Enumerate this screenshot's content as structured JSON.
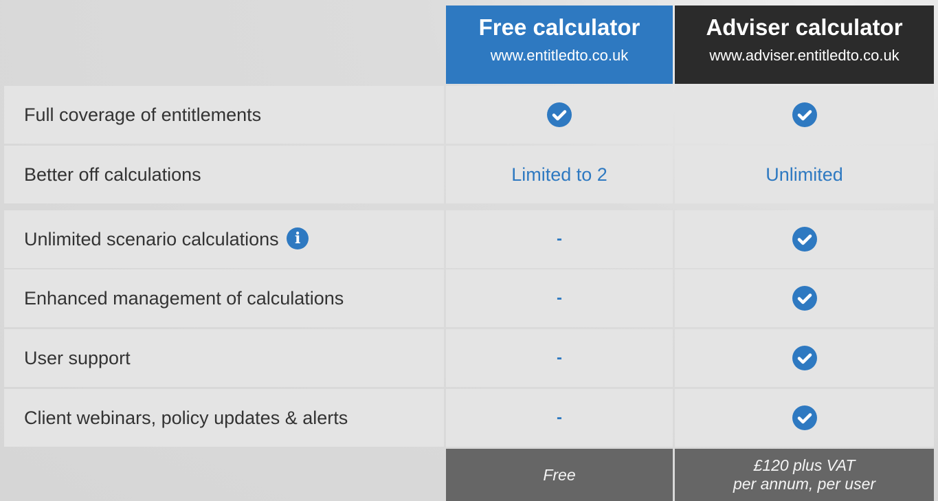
{
  "columns": {
    "free": {
      "title": "Free calculator",
      "url": "www.entitledto.co.uk"
    },
    "adviser": {
      "title": "Adviser calculator",
      "url": "www.adviser.entitledto.co.uk"
    }
  },
  "rows": [
    {
      "label": "Full coverage of entitlements",
      "free": "check-icon",
      "adviser": "check-icon"
    },
    {
      "label": "Better off calculations",
      "free": "Limited to 2",
      "adviser": "Unlimited"
    },
    {
      "label": "Unlimited scenario calculations",
      "info_icon": "info-icon",
      "free": "-",
      "adviser": "check-icon"
    },
    {
      "label": "Enhanced management of calculations",
      "free": "-",
      "adviser": "check-icon"
    },
    {
      "label": "User support",
      "free": "-",
      "adviser": "check-icon"
    },
    {
      "label": "Client webinars, policy updates & alerts",
      "free": "-",
      "adviser": "check-icon"
    }
  ],
  "pricing": {
    "free": "Free",
    "adviser_line1": "£120 plus VAT",
    "adviser_line2": "per annum, per user"
  },
  "colors": {
    "accent_blue": "#2e79c1",
    "dark_header": "#2b2b2b",
    "price_bar": "#666666",
    "row_bg": "#e4e4e4",
    "page_bg": "#d9d9d9"
  }
}
